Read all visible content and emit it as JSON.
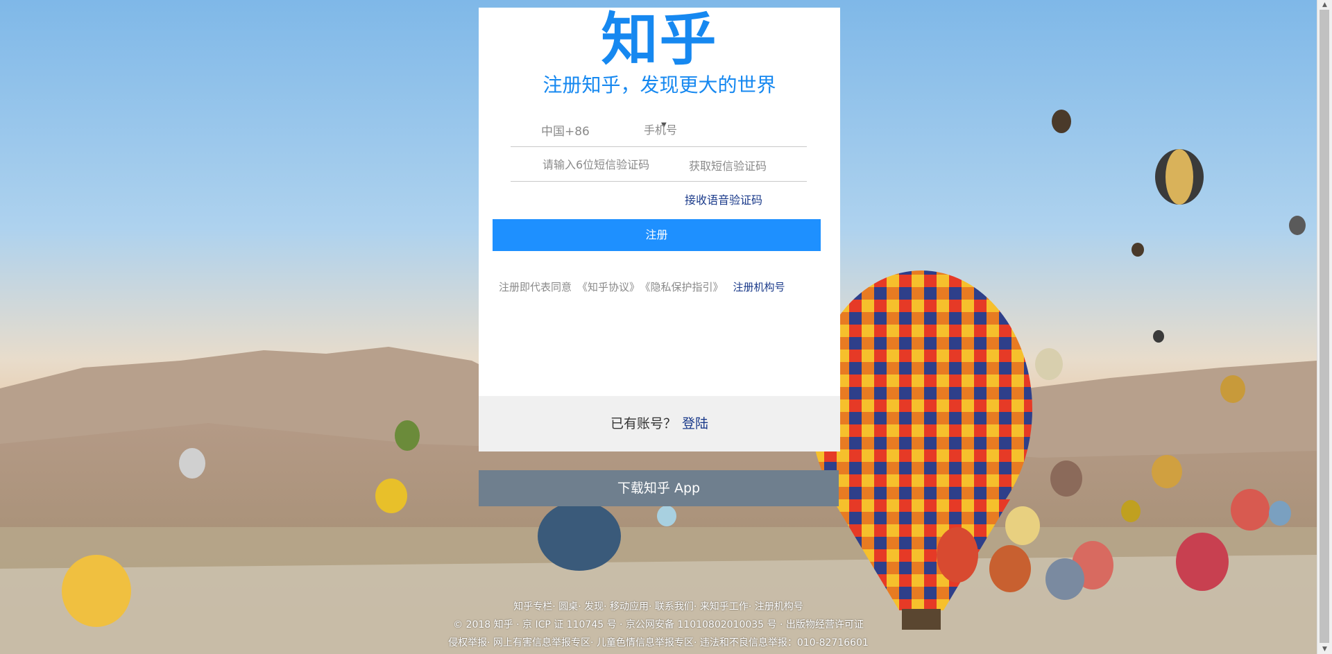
{
  "brand": {
    "logo": "知乎",
    "slogan": "注册知乎，发现更大的世界",
    "color": "#1688f0"
  },
  "form": {
    "country_code": "中国+86",
    "phone_placeholder": "手机号",
    "code_placeholder": "请输入6位短信验证码",
    "get_code_label": "获取短信验证码",
    "voice_code_label": "接收语音验证码",
    "register_label": "注册",
    "register_color": "#1e90ff"
  },
  "agreement": {
    "prefix": "注册即代表同意",
    "terms": "《知乎协议》",
    "privacy": "《隐私保护指引》",
    "org_register": "注册机构号"
  },
  "login": {
    "prompt": "已有账号？",
    "link": "登陆"
  },
  "download": {
    "label": "下载知乎 App",
    "color": "#6f7f8e"
  },
  "footer": {
    "links": [
      "知乎专栏",
      "圆桌",
      "发现",
      "移动应用",
      "联系我们",
      "来知乎工作",
      "注册机构号"
    ],
    "copyright": "© 2018 知乎 · 京 ICP 证 110745 号 · 京公网安备 11010802010035 号 · 出版物经营许可证",
    "report": [
      "侵权举报",
      "网上有害信息举报专区",
      "儿童色情信息举报专区",
      "违法和不良信息举报：010-82716601"
    ]
  }
}
